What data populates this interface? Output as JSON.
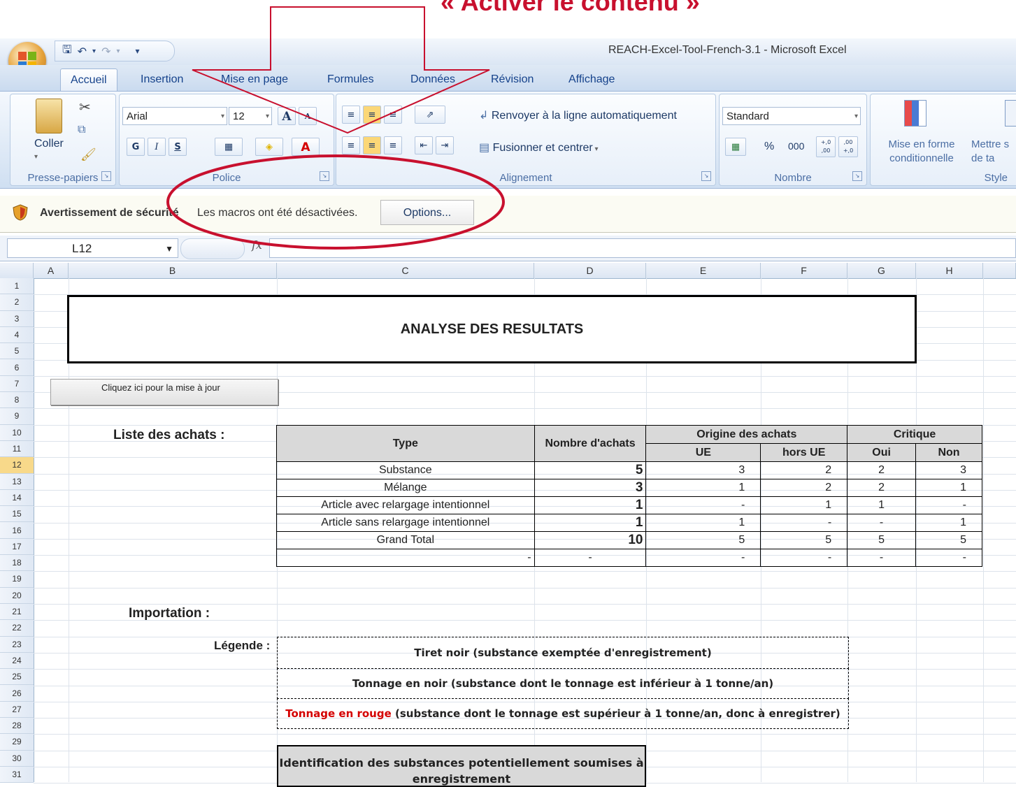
{
  "annotation": {
    "caption": "« Activer le contenu »",
    "color": "#c8102e"
  },
  "titlebar": {
    "title": "REACH-Excel-Tool-French-3.1 - Microsoft Excel"
  },
  "quick_access": {
    "icons": [
      "save-icon",
      "undo-icon",
      "redo-icon",
      "customize-icon"
    ]
  },
  "tabs": [
    "Accueil",
    "Insertion",
    "Mise en page",
    "Formules",
    "Données",
    "Révision",
    "Affichage"
  ],
  "ribbon": {
    "clipboard": {
      "label": "Presse-papiers",
      "paste": "Coller"
    },
    "font": {
      "label": "Police",
      "font_name": "Arial",
      "font_size": "12",
      "bold": "G",
      "italic": "I",
      "underline": "S",
      "grow": "A",
      "shrink": "A",
      "color": "A"
    },
    "alignment": {
      "label": "Alignement",
      "wrap": "Renvoyer à la ligne automatiquement",
      "merge": "Fusionner et centrer"
    },
    "number": {
      "label": "Nombre",
      "format": "Standard",
      "percent": "%",
      "thousands": "000",
      "inc": "+,0 ,00",
      "dec": ",00 +,0"
    },
    "styles": {
      "label": "Style",
      "conditional": "Mise en forme conditionnelle",
      "table": "Mettre s de ta"
    }
  },
  "security_bar": {
    "title": "Avertissement de sécurité",
    "message": "Les macros ont été désactivées.",
    "button": "Options..."
  },
  "formula_bar": {
    "name_box": "L12",
    "fx": "fx"
  },
  "sheet": {
    "columns": [
      "A",
      "B",
      "C",
      "D",
      "E",
      "F",
      "G",
      "H"
    ],
    "rows": [
      "1",
      "2",
      "3",
      "4",
      "5",
      "6",
      "7",
      "8",
      "9",
      "10",
      "11",
      "12",
      "13",
      "14",
      "15",
      "16",
      "17",
      "18",
      "19",
      "20",
      "21",
      "22",
      "23",
      "24",
      "25",
      "26",
      "27",
      "28",
      "29",
      "30",
      "31"
    ],
    "title": "ANALYSE DES RESULTATS",
    "update_button": "Cliquez ici pour la mise à jour",
    "purchases_label": "Liste des achats :",
    "purchases_table": {
      "headers": {
        "type": "Type",
        "count": "Nombre d'achats",
        "origin": "Origine des achats",
        "critical": "Critique",
        "eu": "UE",
        "non_eu": "hors UE",
        "yes": "Oui",
        "no": "Non"
      },
      "rows": [
        {
          "type": "Substance",
          "count": "5",
          "eu": "3",
          "non_eu": "2",
          "yes": "2",
          "no": "3"
        },
        {
          "type": "Mélange",
          "count": "3",
          "eu": "1",
          "non_eu": "2",
          "yes": "2",
          "no": "1"
        },
        {
          "type": "Article avec relargage intentionnel",
          "count": "1",
          "eu": "-",
          "non_eu": "1",
          "yes": "1",
          "no": "-"
        },
        {
          "type": "Article sans relargage intentionnel",
          "count": "1",
          "eu": "1",
          "non_eu": "-",
          "yes": "-",
          "no": "1"
        },
        {
          "type": "Grand Total",
          "count": "10",
          "eu": "5",
          "non_eu": "5",
          "yes": "5",
          "no": "5"
        },
        {
          "type": "-",
          "count": "-",
          "eu": "-",
          "non_eu": "-",
          "yes": "-",
          "no": "-"
        }
      ]
    },
    "import_label": "Importation :",
    "legend_label": "Légende :",
    "legend": {
      "item1": "Tiret  noir (substance exemptée d'enregistrement)",
      "item2": "Tonnage en noir (substance dont le tonnage est inférieur à 1 tonne/an)",
      "item3_red": "Tonnage en rouge",
      "item3_rest": " (substance dont le tonnage est supérieur à 1 tonne/an, donc à enregistrer)",
      "red_color": "#d40000"
    },
    "identification": "Identification des substances potentiellement soumises à enregistrement"
  }
}
